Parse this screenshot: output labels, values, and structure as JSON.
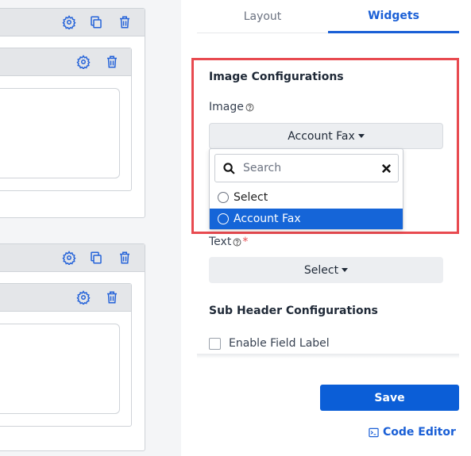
{
  "tabs": [
    {
      "label": "Layout",
      "active": false
    },
    {
      "label": "Widgets",
      "active": true
    }
  ],
  "image_config": {
    "title": "Image Configurations",
    "image_label": "Image",
    "image_value": "Account Fax",
    "search_placeholder": "Search",
    "options": [
      "Select",
      "Account Fax"
    ],
    "selected_option": "Account Fax"
  },
  "text_field": {
    "label": "Text",
    "required_mark": "*",
    "value": "Select"
  },
  "sub_header": {
    "title": "Sub Header Configurations",
    "enable_field_label": "Enable Field Label"
  },
  "actions": {
    "save_label": "Save",
    "code_editor_label": "Code Editor"
  },
  "colors": {
    "accent": "#1a5fd6",
    "highlight_border": "#e84a50",
    "selected_option_bg": "#1565d8",
    "icon_blue": "#2563d9"
  },
  "icons": [
    "gear-icon",
    "copy-icon",
    "trash-icon",
    "help-icon",
    "search-icon",
    "close-icon",
    "terminal-icon",
    "caret-down-icon"
  ]
}
